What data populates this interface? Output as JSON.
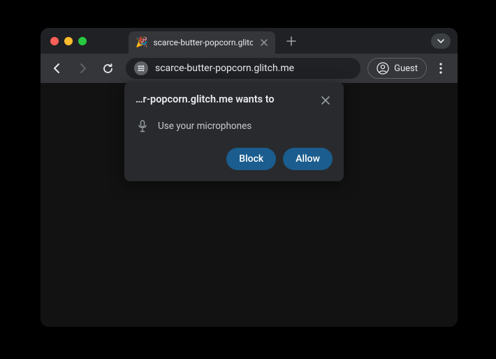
{
  "tab": {
    "favicon": "🎉",
    "title": "scarce-butter-popcorn.glitch"
  },
  "omnibox": {
    "url": "scarce-butter-popcorn.glitch.me"
  },
  "profile": {
    "label": "Guest"
  },
  "permission": {
    "title": "…r-popcorn.glitch.me wants to",
    "request": "Use your microphones",
    "block": "Block",
    "allow": "Allow"
  }
}
